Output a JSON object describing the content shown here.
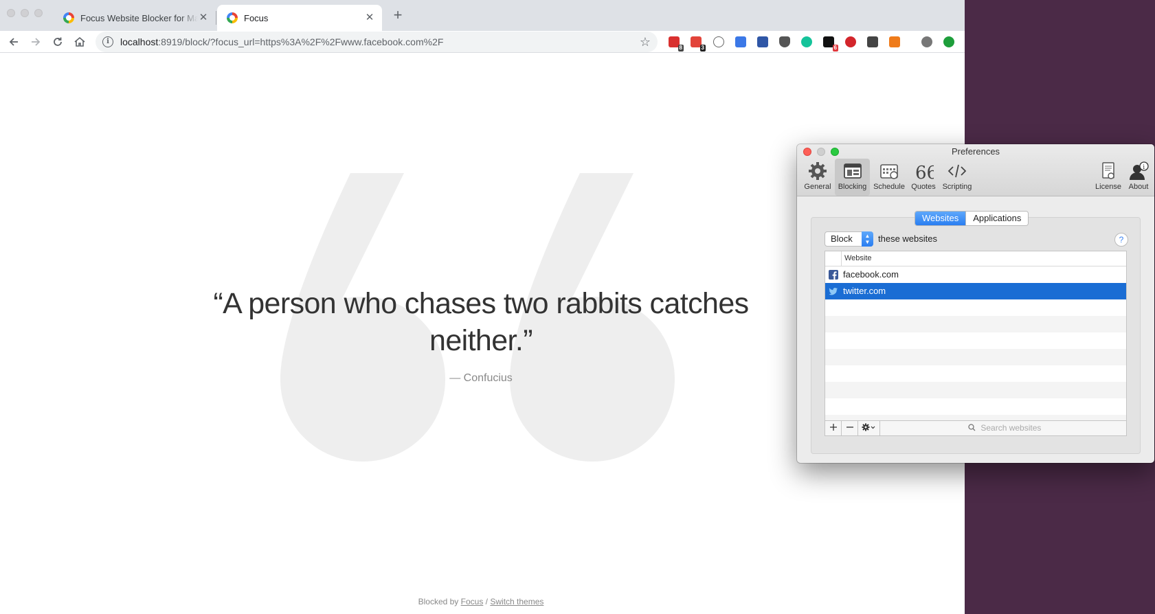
{
  "browser": {
    "tabs": [
      {
        "title": "Focus Website Blocker for Mac",
        "active": false
      },
      {
        "title": "Focus",
        "active": true
      }
    ],
    "new_tab_symbol": "+",
    "url_host": "localhost",
    "url_rest": ":8919/block/?focus_url=https%3A%2F%2Fwww.facebook.com%2F",
    "extension_badges": {
      "ext1": "8",
      "ext2": "3",
      "ext3": "6"
    }
  },
  "page": {
    "quote": "“A person who chases two rabbits catches neither.”",
    "author": "— Confucius",
    "footer_prefix": "Blocked by",
    "footer_link_focus": "Focus",
    "footer_sep": "/",
    "footer_link_themes": "Switch themes"
  },
  "prefs": {
    "title": "Preferences",
    "tabs": {
      "general": "General",
      "blocking": "Blocking",
      "schedule": "Schedule",
      "quotes": "Quotes",
      "scripting": "Scripting",
      "license": "License",
      "about": "About"
    },
    "segments": {
      "websites": "Websites",
      "applications": "Applications"
    },
    "mode_select": "Block",
    "mode_suffix": "these websites",
    "help": "?",
    "table_header": "Website",
    "sites": [
      {
        "name": "facebook.com",
        "icon": "facebook-icon",
        "selected": false
      },
      {
        "name": "twitter.com",
        "icon": "twitter-icon",
        "selected": true
      }
    ],
    "search_placeholder": "Search websites"
  },
  "colors": {
    "desktop": "#4b2a47",
    "selection": "#1a6dd4",
    "accent": "#2a7ef1"
  }
}
